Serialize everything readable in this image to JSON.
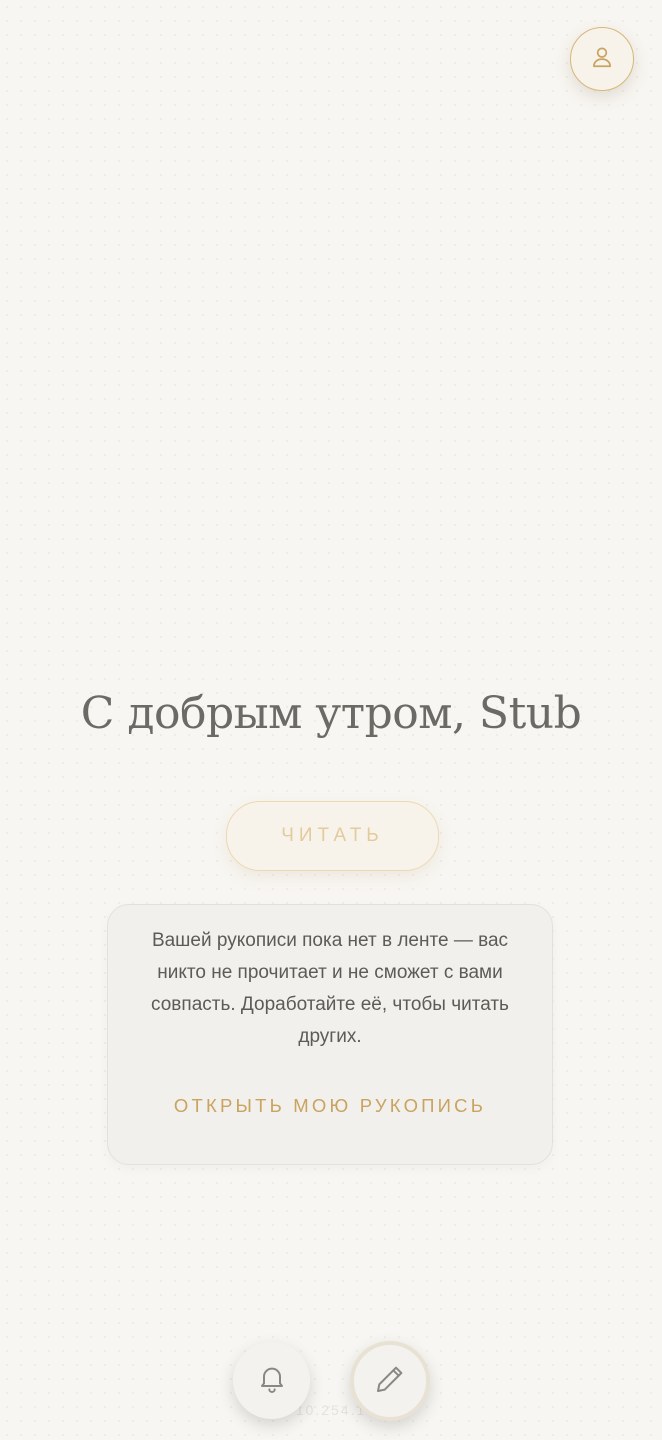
{
  "header": {
    "profile_icon": "user-icon"
  },
  "main": {
    "greeting": "С добрым утром, Stub",
    "read_button_label": "ЧИТАТЬ"
  },
  "notice": {
    "message": "Вашей рукописи пока нет в ленте — вас никто не прочитает и не сможет с вами совпасть. Доработайте её, чтобы читать других.",
    "link_label": "ОТКРЫТЬ МОЮ РУКОПИСЬ"
  },
  "footer": {
    "version": "10.254.1",
    "notifications_icon": "bell-icon",
    "write_icon": "pencil-icon"
  },
  "colors": {
    "accent": "#c9a360",
    "background": "#f8f6f2",
    "text": "#6b6a64"
  }
}
